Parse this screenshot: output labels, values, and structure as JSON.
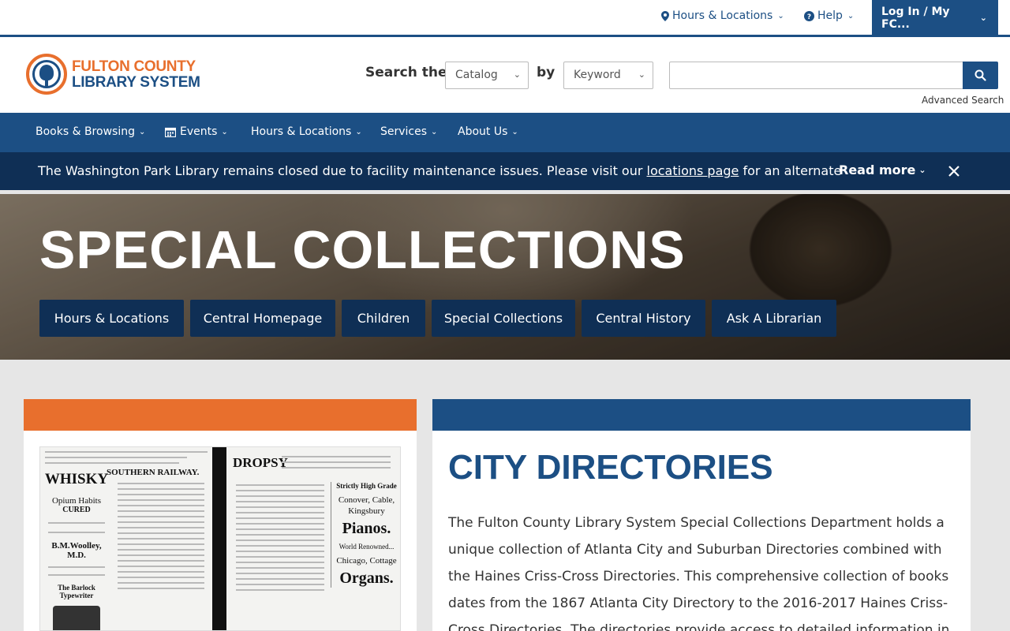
{
  "utility": {
    "hours_label": "Hours & Locations",
    "help_label": "Help",
    "login_label": "Log In / My FC..."
  },
  "header": {
    "logo_line1": "FULTON COUNTY",
    "logo_line2": "LIBRARY SYSTEM",
    "search_the": "Search the",
    "catalog_select": "Catalog",
    "by": "by",
    "keyword_select": "Keyword",
    "search_placeholder": "",
    "advanced_search": "Advanced Search"
  },
  "nav": {
    "items": [
      {
        "label": "Books & Browsing"
      },
      {
        "label": "Events"
      },
      {
        "label": "Hours & Locations"
      },
      {
        "label": "Services"
      },
      {
        "label": "About Us"
      }
    ]
  },
  "alert": {
    "text_before": "The Washington Park Library remains closed due to facility maintenance issues. Please visit our ",
    "link": "locations page",
    "text_after": " for an alternate",
    "read_more": "Read more"
  },
  "hero": {
    "title": "SPECIAL COLLECTIONS",
    "buttons": [
      {
        "label": "Hours & Locations"
      },
      {
        "label": "Central Homepage"
      },
      {
        "label": "Children"
      },
      {
        "label": "Special Collections"
      },
      {
        "label": "Central History"
      },
      {
        "label": "Ask A Librarian"
      }
    ]
  },
  "scan": {
    "railway": "SOUTHERN RAILWAY.",
    "whisky": "WHISKY",
    "opium": "Opium Habits",
    "cured": "CURED",
    "woolley": "B.M.Woolley, M.D.",
    "typewriter": "The Barlock Typewriter",
    "dropsy": "DROPSY",
    "high_grade": "Strictly High Grade",
    "conover": "Conover, Cable, Kingsbury",
    "pianos": "Pianos.",
    "world": "World Renowned...",
    "chicago": "Chicago, Cottage",
    "organs": "Organs."
  },
  "main": {
    "title": "CITY DIRECTORIES",
    "body": "The Fulton County Library System Special Collections Department holds a unique collection of Atlanta City and Suburban Directories combined with the Haines Criss-Cross Directories. This comprehensive collection of books dates from the 1867 Atlanta City Directory to the 2016-2017 Haines Criss-Cross Directories. The directories provide access to detailed information in"
  },
  "colors": {
    "brand_blue": "#1c4f84",
    "brand_orange": "#e86f2d",
    "dark_navy": "#0f2f55"
  }
}
